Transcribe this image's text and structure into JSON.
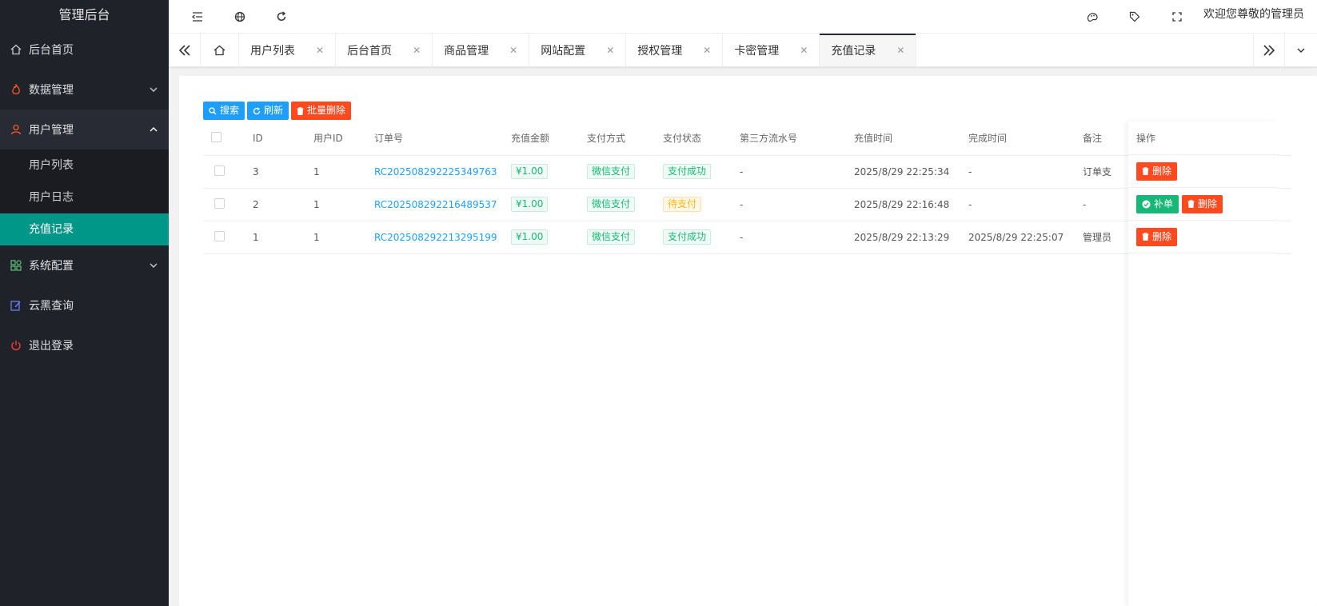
{
  "sidebar": {
    "logo": "管理后台",
    "items": [
      {
        "label": "后台首页"
      },
      {
        "label": "数据管理"
      },
      {
        "label": "用户管理"
      },
      {
        "label": "系统配置"
      },
      {
        "label": "云黑查询"
      },
      {
        "label": "退出登录"
      }
    ],
    "sub_items": [
      {
        "label": "用户列表"
      },
      {
        "label": "用户日志"
      },
      {
        "label": "充值记录"
      }
    ]
  },
  "header": {
    "welcome": "欢迎您尊敬的管理员"
  },
  "tabs": [
    {
      "label": "用户列表"
    },
    {
      "label": "后台首页"
    },
    {
      "label": "商品管理"
    },
    {
      "label": "网站配置"
    },
    {
      "label": "授权管理"
    },
    {
      "label": "卡密管理"
    },
    {
      "label": "充值记录"
    }
  ],
  "toolbar": {
    "search": "搜索",
    "refresh": "刷新",
    "batch_delete": "批量删除"
  },
  "table": {
    "headers": [
      "ID",
      "用户ID",
      "订单号",
      "充值金额",
      "支付方式",
      "支付状态",
      "第三方流水号",
      "充值时间",
      "完成时间",
      "备注",
      "操作"
    ],
    "rows": [
      {
        "id": "3",
        "uid": "1",
        "order": "RC202508292225349763",
        "amount": "¥1.00",
        "method": "微信支付",
        "status": "支付成功",
        "trade_no": "-",
        "created": "2025/8/29 22:25:34",
        "finished": "-",
        "remark": "订单支"
      },
      {
        "id": "2",
        "uid": "1",
        "order": "RC202508292216489537",
        "amount": "¥1.00",
        "method": "微信支付",
        "status": "待支付",
        "trade_no": "-",
        "created": "2025/8/29 22:16:48",
        "finished": "-",
        "remark": "-"
      },
      {
        "id": "1",
        "uid": "1",
        "order": "RC202508292213295199",
        "amount": "¥1.00",
        "method": "微信支付",
        "status": "支付成功",
        "trade_no": "-",
        "created": "2025/8/29 22:13:29",
        "finished": "2025/8/29 22:25:07",
        "remark": "管理员"
      }
    ],
    "actions": {
      "delete": "删除",
      "repair": "补单"
    }
  }
}
